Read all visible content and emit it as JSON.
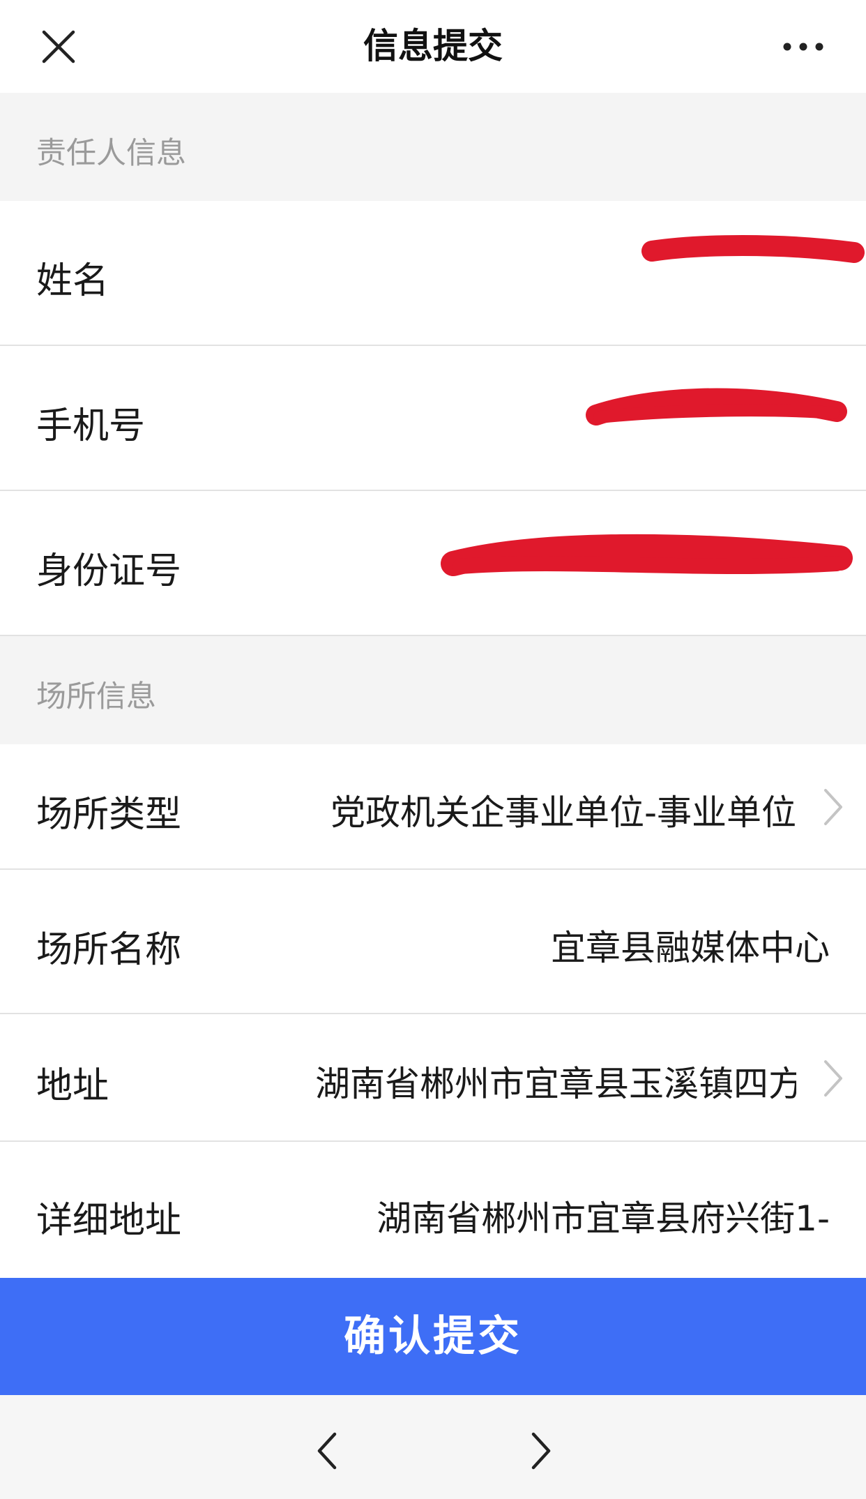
{
  "topbar": {
    "title": "信息提交",
    "close_icon": "close-icon",
    "more_icon": "more-dots-icon"
  },
  "sections": {
    "responsible": {
      "title": "责任人信息"
    },
    "venue": {
      "title": "场所信息"
    }
  },
  "fields": {
    "name": {
      "label": "姓名",
      "value": ""
    },
    "phone": {
      "label": "手机号",
      "value": ""
    },
    "id_number": {
      "label": "身份证号",
      "value": ""
    },
    "venue_type": {
      "label": "场所类型",
      "value": "党政机关企事业单位-事业单位"
    },
    "venue_name": {
      "label": "场所名称",
      "value": "宜章县融媒体中心"
    },
    "address": {
      "label": "地址",
      "value": "湖南省郴州市宜章县玉溪镇四方"
    },
    "detail_address": {
      "label": "详细地址",
      "value": "湖南省郴州市宜章县府兴街1-"
    }
  },
  "submit": {
    "label": "确认提交",
    "color": "#3e6ef6"
  },
  "redaction_color": "#e0192c"
}
